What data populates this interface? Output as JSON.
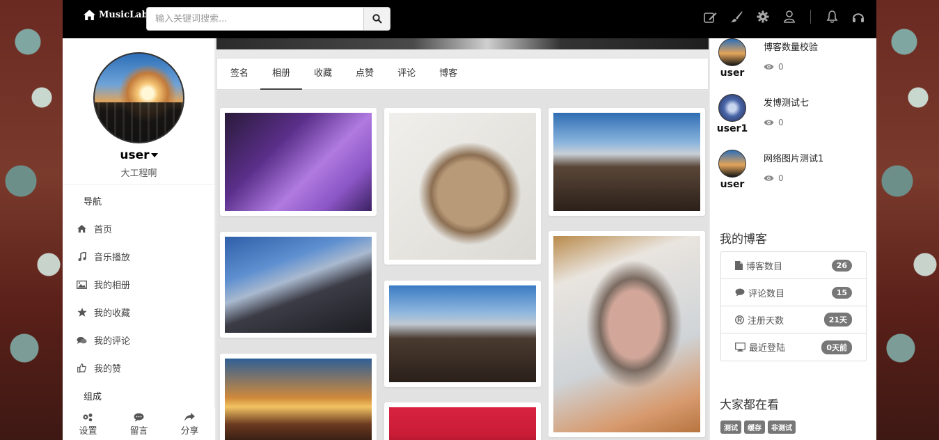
{
  "header": {
    "brand": "MusicLab",
    "search_placeholder": "输入关键词搜索...",
    "icons": [
      "edit-icon",
      "brush-icon",
      "gear-icon",
      "user-icon",
      "bell-icon",
      "headphones-icon"
    ]
  },
  "profile": {
    "name": "user",
    "subtitle": "大工程啊"
  },
  "nav": {
    "title": "导航",
    "items": [
      {
        "label": "首页",
        "icon": "home-icon"
      },
      {
        "label": "音乐播放",
        "icon": "music-icon"
      },
      {
        "label": "我的相册",
        "icon": "image-icon"
      },
      {
        "label": "我的收藏",
        "icon": "star-icon"
      },
      {
        "label": "我的评论",
        "icon": "comments-icon"
      },
      {
        "label": "我的赞",
        "icon": "thumbs-up-icon"
      }
    ],
    "group_title": "组成"
  },
  "bottom_tools": [
    {
      "label": "设置",
      "icon": "cogs-icon"
    },
    {
      "label": "留言",
      "icon": "comment-icon"
    },
    {
      "label": "分享",
      "icon": "share-icon"
    }
  ],
  "tabs": [
    {
      "label": "签名",
      "active": false
    },
    {
      "label": "相册",
      "active": true
    },
    {
      "label": "收藏",
      "active": false
    },
    {
      "label": "点赞",
      "active": false
    },
    {
      "label": "评论",
      "active": false
    },
    {
      "label": "博客",
      "active": false
    }
  ],
  "recent_posts": [
    {
      "title": "博客数量校验",
      "author": "user",
      "views": "0"
    },
    {
      "title": "发博测试七",
      "author": "user1",
      "views": "0"
    },
    {
      "title": "网络图片测试1",
      "author": "user",
      "views": "0"
    }
  ],
  "my_blog": {
    "title": "我的博客",
    "stats": [
      {
        "label": "博客数目",
        "value": "26",
        "icon": "file-icon"
      },
      {
        "label": "评论数目",
        "value": "15",
        "icon": "comment-icon"
      },
      {
        "label": "注册天数",
        "value": "21天",
        "icon": "registered-icon"
      },
      {
        "label": "最近登陆",
        "value": "0天前",
        "icon": "monitor-icon"
      }
    ]
  },
  "trending": {
    "title": "大家都在看",
    "tags": [
      "测试",
      "缓存",
      "非测试"
    ]
  },
  "colors": {
    "topbar": "#000000",
    "badge": "#777777"
  }
}
